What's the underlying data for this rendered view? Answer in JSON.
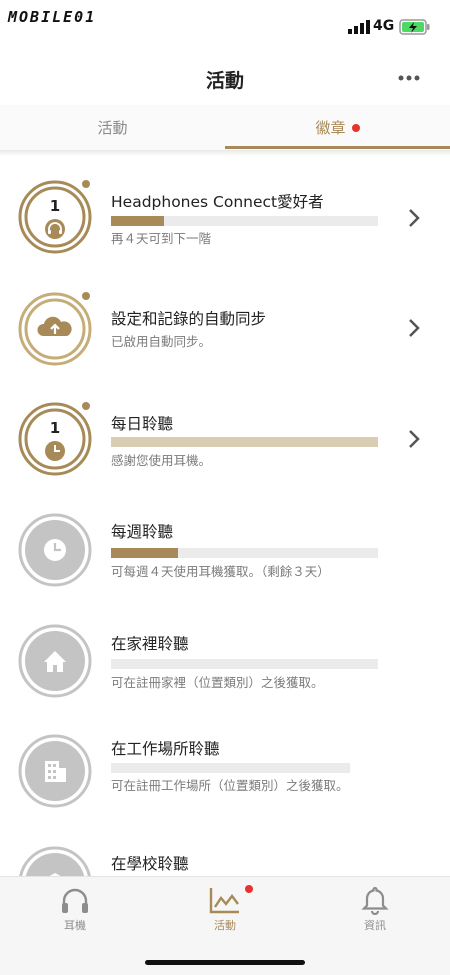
{
  "status_bar": {
    "network": "4G",
    "logo_text": "MOBILE01"
  },
  "header": {
    "title": "活動",
    "more_icon": "more-dots-icon"
  },
  "tabs": [
    {
      "label": "活動",
      "active": false
    },
    {
      "label": "徽章",
      "active": true,
      "has_dot": true
    }
  ],
  "colors": {
    "accent": "#a78a57",
    "accent_light": "#d9cdb3",
    "inactive_gray": "#c4c4c4",
    "notification": "#e8322d"
  },
  "badges": [
    {
      "title": "Headphones Connect愛好者",
      "subtitle": "再４天可到下一階",
      "level": "1",
      "icon": "headphones-icon",
      "progress": 0.2,
      "earned": true,
      "has_chevron": true,
      "new_dot": true
    },
    {
      "title": "設定和記錄的自動同步",
      "subtitle": "已啟用自動同步。",
      "icon": "cloud-upload-icon",
      "earned": true,
      "has_chevron": true,
      "new_dot": true
    },
    {
      "title": "每日聆聽",
      "subtitle": "感謝您使用耳機。",
      "level": "1",
      "icon": "clock-icon",
      "progress": 1.0,
      "earned": true,
      "has_chevron": true,
      "new_dot": true
    },
    {
      "title": "每週聆聽",
      "subtitle": "可每週４天使用耳機獲取。（剩餘３天）",
      "icon": "clock-icon",
      "progress": 0.25,
      "earned": false,
      "has_chevron": false
    },
    {
      "title": "在家裡聆聽",
      "subtitle": "可在註冊家裡（位置類別）之後獲取。",
      "icon": "home-icon",
      "progress": 0,
      "earned": false,
      "has_chevron": false
    },
    {
      "title": "在工作場所聆聽",
      "subtitle": "可在註冊工作場所（位置類別）之後獲取。",
      "icon": "building-icon",
      "progress": 0,
      "earned": false,
      "has_chevron": false
    },
    {
      "title": "在學校聆聽",
      "icon": "school-icon",
      "earned": false,
      "has_chevron": false
    }
  ],
  "bottom_nav": [
    {
      "label": "耳機",
      "icon": "headphones-icon",
      "active": false
    },
    {
      "label": "活動",
      "icon": "activity-chart-icon",
      "active": true,
      "has_dot": true
    },
    {
      "label": "資訊",
      "icon": "bell-icon",
      "active": false
    }
  ]
}
